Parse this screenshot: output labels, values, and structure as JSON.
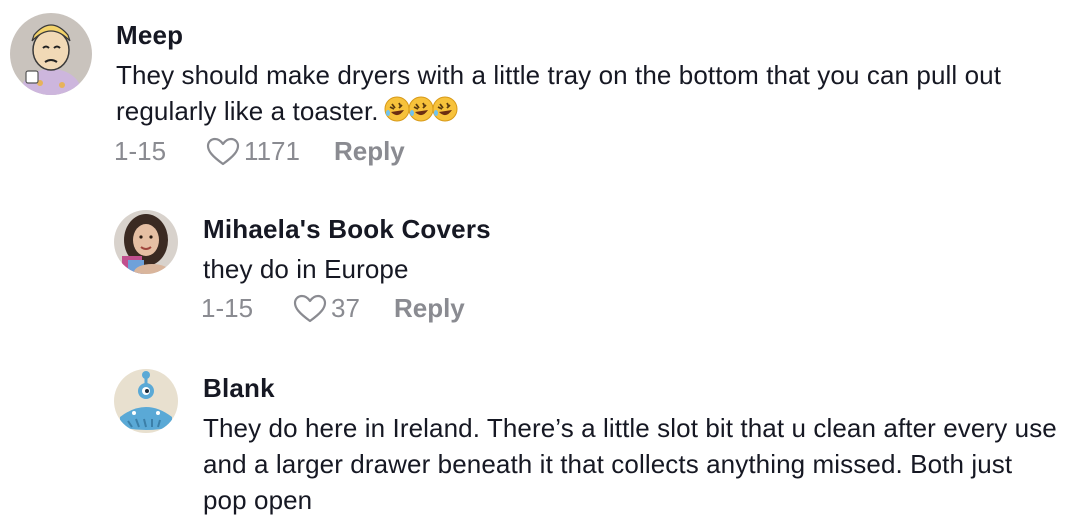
{
  "comments": [
    {
      "author": "Meep",
      "text": "They should make dryers with a little tray on the bottom that you can pull out regularly like a toaster.",
      "emoji_icons": [
        "rofl-emoji-icon",
        "rofl-emoji-icon",
        "rofl-emoji-icon"
      ],
      "date": "1-15",
      "likes": "1171",
      "reply_label": "Reply"
    },
    {
      "author": "Mihaela's Book Covers",
      "text": "they do in Europe",
      "date": "1-15",
      "likes": "37",
      "reply_label": "Reply"
    },
    {
      "author": "Blank",
      "text": "They do here in Ireland. There’s a little slot bit that u clean after every use and a larger drawer beneath it that collects anything missed. Both just pop open"
    }
  ],
  "colors": {
    "text": "#161823",
    "muted": "#8a8b91",
    "background": "#ffffff"
  }
}
